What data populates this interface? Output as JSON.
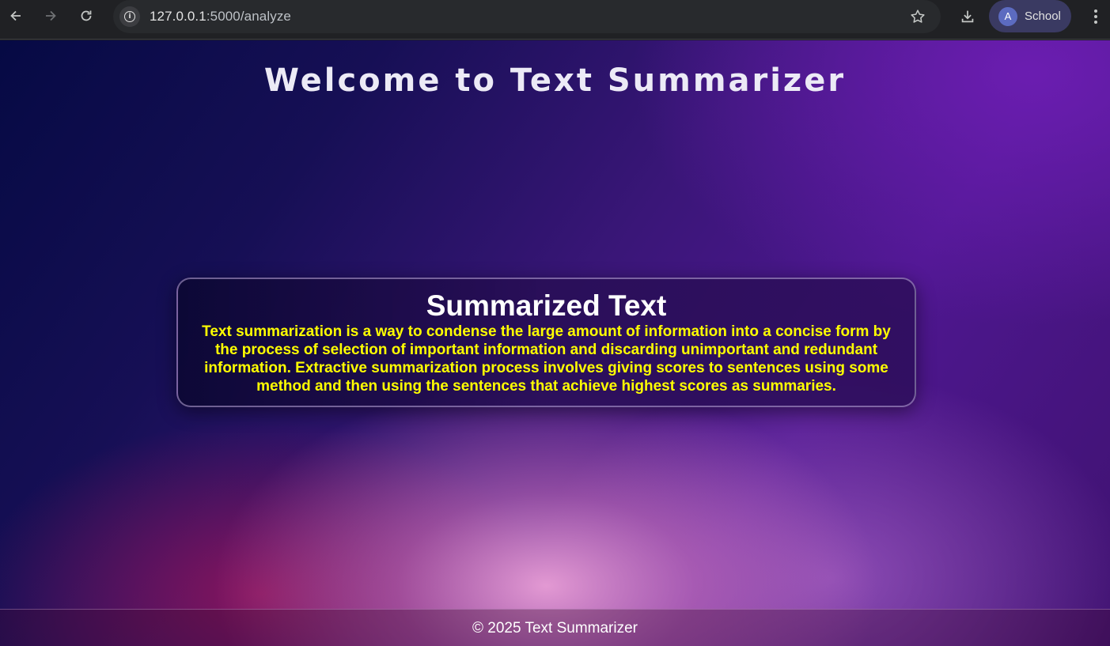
{
  "browser": {
    "url_host": "127.0.0.1",
    "url_port_path": ":5000/analyze",
    "profile_initial": "A",
    "profile_name": "School"
  },
  "page": {
    "title": "Welcome to Text Summarizer",
    "card_heading": "Summarized Text",
    "summary": "Text summarization is a way to condense the large amount of information into a concise form by the process of selection of important information and discarding unimportant and redundant information. Extractive summarization process involves giving scores to sentences using some method and then using the sentences that achieve highest scores as summaries.",
    "footer": "© 2025 Text Summarizer"
  },
  "colors": {
    "summary_text": "#ffff00",
    "heading_text": "#ffffff"
  }
}
